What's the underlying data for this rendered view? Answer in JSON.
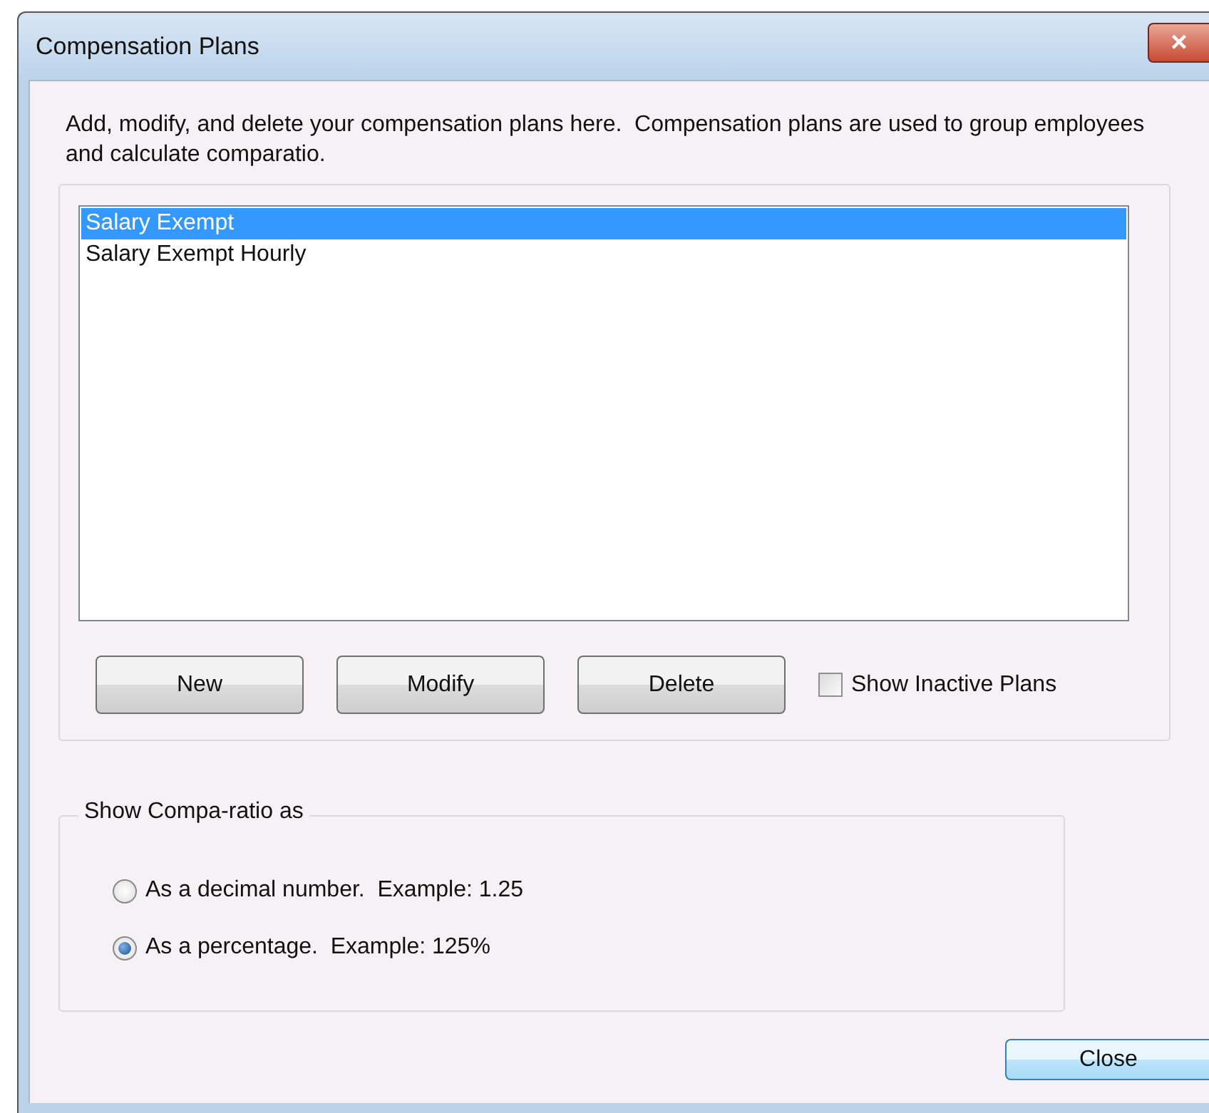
{
  "window": {
    "title": "Compensation Plans",
    "close_icon": "×"
  },
  "description": "Add, modify, and delete your compensation plans here.  Compensation plans are used to group employees and calculate comparatio.",
  "plans": [
    {
      "label": "Salary Exempt",
      "selected": true
    },
    {
      "label": "Salary Exempt Hourly",
      "selected": false
    }
  ],
  "plan_buttons": [
    "New",
    "Modify",
    "Delete"
  ],
  "show_inactive": {
    "label": "Show Inactive Plans",
    "checked": false
  },
  "compa_ratio": {
    "legend": "Show Compa-ratio as",
    "options": [
      {
        "label": "As a decimal number.  Example: 1.25",
        "selected": false
      },
      {
        "label": "As a percentage.  Example: 125%",
        "selected": true
      }
    ]
  },
  "close_button": "Close"
}
